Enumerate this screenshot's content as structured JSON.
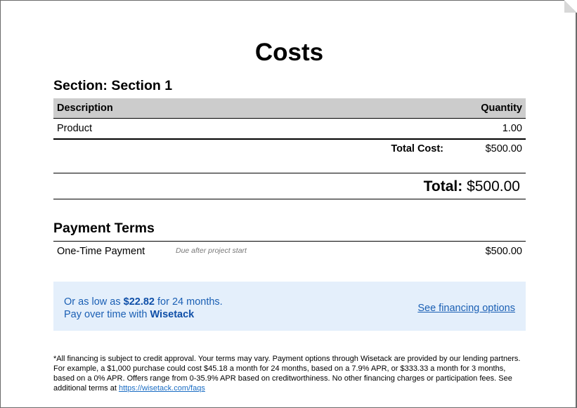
{
  "document": {
    "title": "Costs"
  },
  "section": {
    "heading": "Section: Section 1",
    "columns": {
      "description": "Description",
      "quantity": "Quantity"
    },
    "rows": [
      {
        "description": "Product",
        "quantity": "1.00"
      }
    ],
    "total_cost_label": "Total Cost:",
    "total_cost_value": "$500.00"
  },
  "grand_total": {
    "label": "Total:",
    "value": "$500.00"
  },
  "payment_terms": {
    "heading": "Payment Terms",
    "items": [
      {
        "name": "One-Time Payment",
        "note": "Due after project start",
        "amount": "$500.00"
      }
    ]
  },
  "financing": {
    "line1_prefix": "Or as low as",
    "line1_amount": "$22.82",
    "line1_suffix": "for 24 months.",
    "line2_prefix": "Pay over time with",
    "line2_brand": "Wisetack",
    "link_label": "See financing options",
    "box_color": "#e4effb",
    "text_color": "#1a5fb4"
  },
  "disclaimer": {
    "text": "*All financing is subject to credit approval. Your terms may vary. Payment options through Wisetack are provided by our lending partners. For example, a $1,000 purchase could cost $45.18 a month for 24 months, based on a 7.9% APR, or $333.33 a month for 3 months, based on a 0% APR. Offers range from 0-35.9% APR based on creditworthiness. No other financing charges or participation fees. See additional terms at",
    "link": "https://wisetack.com/faqs"
  }
}
